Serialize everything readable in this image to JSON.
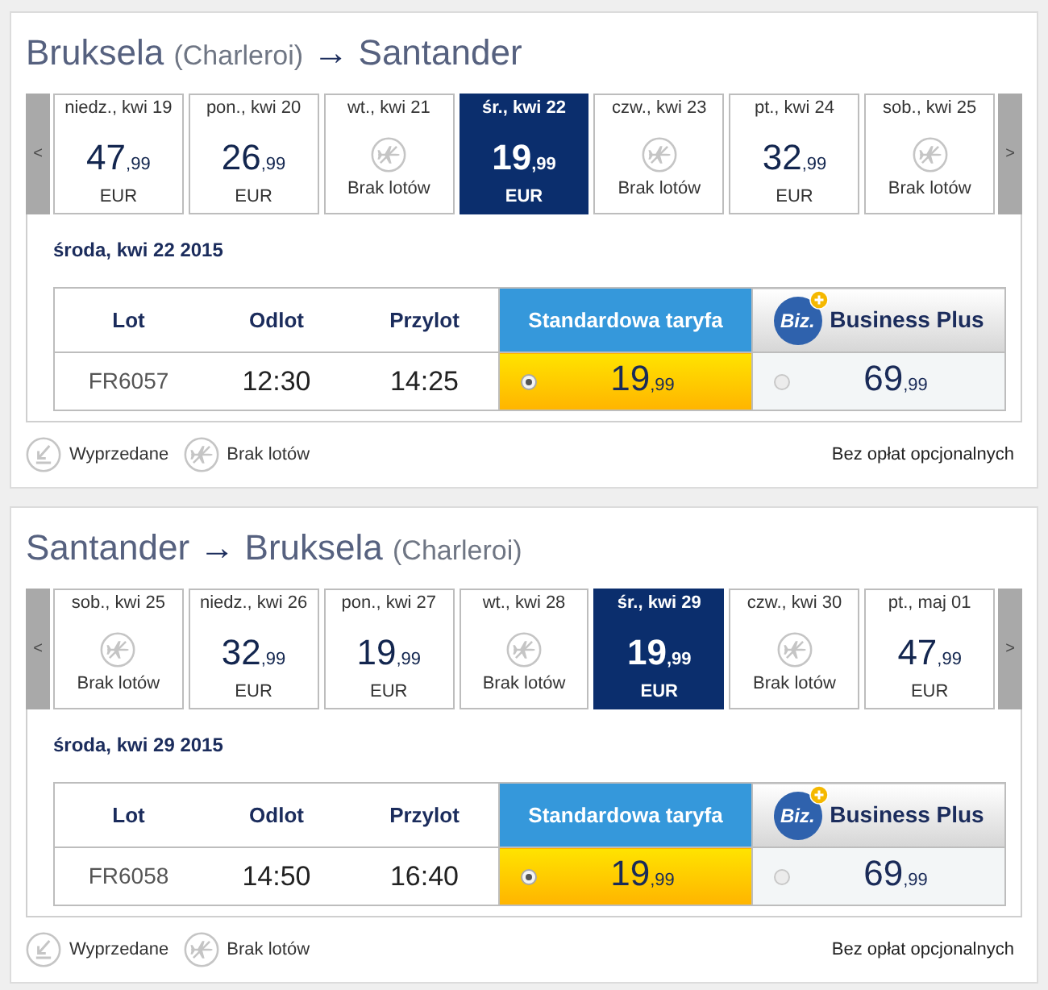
{
  "sections": [
    {
      "title": [
        {
          "kind": "city",
          "text": "Bruksela"
        },
        {
          "kind": "airport",
          "text": "(Charleroi)"
        },
        {
          "kind": "arrow",
          "text": "→"
        },
        {
          "kind": "city",
          "text": "Santander"
        }
      ],
      "prev_button": "<",
      "next_button": ">",
      "days": [
        {
          "kind": "fare",
          "label": "niedz., kwi 19",
          "amount": "47",
          "decimals": ",99",
          "currency": "EUR",
          "selected": false
        },
        {
          "kind": "fare",
          "label": "pon., kwi 20",
          "amount": "26",
          "decimals": ",99",
          "currency": "EUR",
          "selected": false
        },
        {
          "kind": "no_flights",
          "label": "wt., kwi 21",
          "status": "Brak lotów",
          "selected": false
        },
        {
          "kind": "fare",
          "label": "śr., kwi 22",
          "amount": "19",
          "decimals": ",99",
          "currency": "EUR",
          "selected": true
        },
        {
          "kind": "no_flights",
          "label": "czw., kwi 23",
          "status": "Brak lotów",
          "selected": false
        },
        {
          "kind": "fare",
          "label": "pt., kwi 24",
          "amount": "32",
          "decimals": ",99",
          "currency": "EUR",
          "selected": false
        },
        {
          "kind": "no_flights",
          "label": "sob., kwi 25",
          "status": "Brak lotów",
          "selected": false
        }
      ],
      "date_heading": "środa, kwi 22 2015",
      "columns": [
        "Lot",
        "Odlot",
        "Przylot"
      ],
      "fare_headers": [
        {
          "kind": "standard",
          "label": "Standardowa taryfa"
        },
        {
          "kind": "business",
          "label": "Business Plus",
          "logo": "Biz."
        }
      ],
      "flights": [
        {
          "flight": "FR6057",
          "departure": "12:30",
          "arrival": "14:25",
          "fares": [
            {
              "amount": "19",
              "decimals": ",99",
              "selected": true
            },
            {
              "amount": "69",
              "decimals": ",99",
              "selected": false
            }
          ]
        }
      ],
      "legend": [
        {
          "kind": "sold_out",
          "label": "Wyprzedane"
        },
        {
          "kind": "no_flights",
          "label": "Brak lotów"
        }
      ],
      "fees_note": "Bez opłat opcjonalnych"
    },
    {
      "title": [
        {
          "kind": "city",
          "text": "Santander"
        },
        {
          "kind": "arrow",
          "text": "→"
        },
        {
          "kind": "city",
          "text": "Bruksela"
        },
        {
          "kind": "airport",
          "text": "(Charleroi)"
        }
      ],
      "prev_button": "<",
      "next_button": ">",
      "days": [
        {
          "kind": "no_flights",
          "label": "sob., kwi 25",
          "status": "Brak lotów",
          "selected": false
        },
        {
          "kind": "fare",
          "label": "niedz., kwi 26",
          "amount": "32",
          "decimals": ",99",
          "currency": "EUR",
          "selected": false
        },
        {
          "kind": "fare",
          "label": "pon., kwi 27",
          "amount": "19",
          "decimals": ",99",
          "currency": "EUR",
          "selected": false
        },
        {
          "kind": "no_flights",
          "label": "wt., kwi 28",
          "status": "Brak lotów",
          "selected": false
        },
        {
          "kind": "fare",
          "label": "śr., kwi 29",
          "amount": "19",
          "decimals": ",99",
          "currency": "EUR",
          "selected": true
        },
        {
          "kind": "no_flights",
          "label": "czw., kwi 30",
          "status": "Brak lotów",
          "selected": false
        },
        {
          "kind": "fare",
          "label": "pt., maj 01",
          "amount": "47",
          "decimals": ",99",
          "currency": "EUR",
          "selected": false
        }
      ],
      "date_heading": "środa, kwi 29 2015",
      "columns": [
        "Lot",
        "Odlot",
        "Przylot"
      ],
      "fare_headers": [
        {
          "kind": "standard",
          "label": "Standardowa taryfa"
        },
        {
          "kind": "business",
          "label": "Business Plus",
          "logo": "Biz."
        }
      ],
      "flights": [
        {
          "flight": "FR6058",
          "departure": "14:50",
          "arrival": "16:40",
          "fares": [
            {
              "amount": "19",
              "decimals": ",99",
              "selected": true
            },
            {
              "amount": "69",
              "decimals": ",99",
              "selected": false
            }
          ]
        }
      ],
      "legend": [
        {
          "kind": "sold_out",
          "label": "Wyprzedane"
        },
        {
          "kind": "no_flights",
          "label": "Brak lotów"
        }
      ],
      "fees_note": "Bez opłat opcjonalnych"
    }
  ]
}
